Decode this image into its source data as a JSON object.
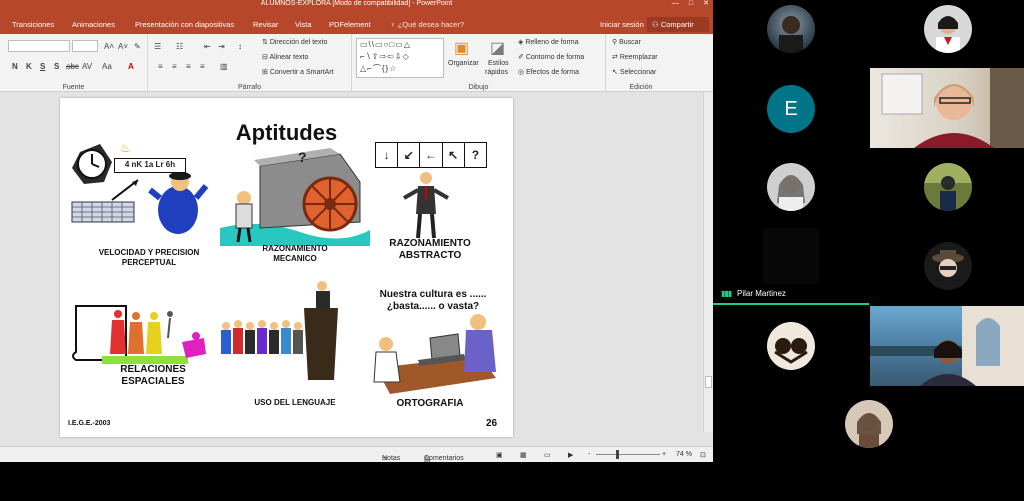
{
  "window": {
    "title": "ALUMNOS-EXPLORA [Modo de compatibilidad] - PowerPoint",
    "minimize": "—",
    "maximize": "□",
    "close": "✕"
  },
  "tabs": [
    "Transiciones",
    "Animaciones",
    "Presentación con diapositivas",
    "Revisar",
    "Vista",
    "PDFelement"
  ],
  "tell_me": "¿Qué desea hacer?",
  "signin": "Iniciar sesión",
  "share": "Compartir",
  "ribbon": {
    "font_group": "Fuente",
    "paragraph_group": "Párrafo",
    "drawing_group": "Dibujo",
    "editing_group": "Edición",
    "font_buttons": [
      "N",
      "K",
      "S",
      "S",
      "abc",
      "AV",
      "Aa"
    ],
    "text_direction": "Dirección del texto",
    "align_text": "Alinear texto",
    "convert_smartart": "Convertir a SmartArt",
    "organize": "Organizar",
    "quick_styles_1": "Estilos",
    "quick_styles_2": "rápidos",
    "shape_fill": "Relleno de forma",
    "shape_outline": "Contorno de forma",
    "shape_effects": "Efectos de forma",
    "find": "Buscar",
    "replace": "Reemplazar",
    "select": "Seleccionar"
  },
  "slide": {
    "title": "Aptitudes",
    "code_text": "4  nK 1a Lr 6h",
    "sequence": [
      "↓",
      "↙",
      "←",
      "↖",
      "?"
    ],
    "gear_question": "?",
    "caption_velocidad": "VELOCIDAD Y PRECISION\nPERCEPTUAL",
    "caption_mecanico": "RAZONAMIENTO\nMECANICO",
    "caption_abstracto": "RAZONAMIENTO\nABSTRACTO",
    "caption_espaciales": "RELACIONES\nESPACIALES",
    "caption_lenguaje": "USO DEL LENGUAJE",
    "caption_ortografia": "ORTOGRAFIA",
    "culture_text": "Nuestra cultura es ......\n¿basta...... o vasta?",
    "footer": "I.E.G.E.-2003",
    "page_number": "26"
  },
  "statusbar": {
    "notes": "Notas",
    "comments": "Comentarios",
    "zoom_minus": "-",
    "zoom_plus": "+",
    "zoom": "74 %"
  },
  "participants": {
    "initial_e": "E",
    "active_name": "Pilar Martinez"
  },
  "colors": {
    "ppt_accent": "#b7472a",
    "teams_active": "#1ecb8d",
    "avatar_e": "#007589"
  }
}
